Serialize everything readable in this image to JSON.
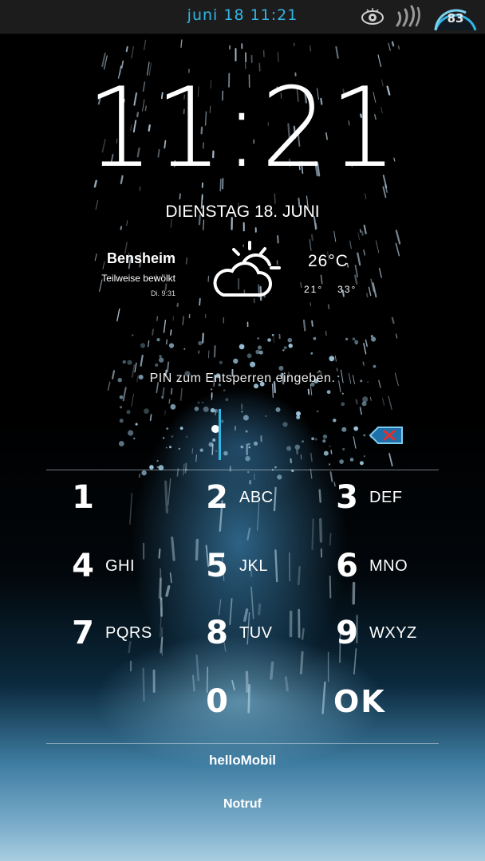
{
  "status_bar": {
    "time": "juni 18 11:21",
    "battery_level": "83",
    "icons": [
      "eye-icon",
      "signal-strength-icon",
      "battery-icon"
    ],
    "accent_color": "#33b5e5"
  },
  "lockscreen": {
    "clock": "11:21",
    "date": "DIENSTAG 18. JUNI"
  },
  "weather": {
    "city": "Bensheim",
    "condition": "Teilweise bewölkt",
    "updated": "Di. 9:31",
    "icon": "partly-cloudy-icon",
    "temperature": "26°C",
    "temp_low": "21°",
    "temp_high": "33°"
  },
  "pin": {
    "prompt": "PIN zum Entsperren eingeben.",
    "entered_digits": 1
  },
  "keypad": {
    "keys": [
      {
        "digit": "1",
        "letters": ""
      },
      {
        "digit": "2",
        "letters": "ABC"
      },
      {
        "digit": "3",
        "letters": "DEF"
      },
      {
        "digit": "4",
        "letters": "GHI"
      },
      {
        "digit": "5",
        "letters": "JKL"
      },
      {
        "digit": "6",
        "letters": "MNO"
      },
      {
        "digit": "7",
        "letters": "PQRS"
      },
      {
        "digit": "8",
        "letters": "TUV"
      },
      {
        "digit": "9",
        "letters": "WXYZ"
      },
      {
        "digit": "0",
        "letters": ""
      }
    ],
    "ok_label": "OK"
  },
  "footer": {
    "carrier": "helloMobil",
    "emergency_label": "Notruf"
  }
}
